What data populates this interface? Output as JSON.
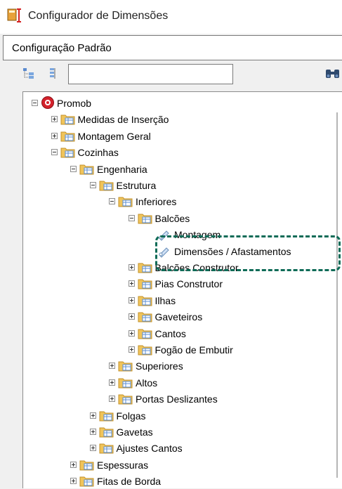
{
  "window": {
    "title": "Configurador de Dimensões",
    "icon": "dimension-configurator-icon"
  },
  "config": {
    "selected": "Configuração Padrão"
  },
  "toolbar": {
    "search_value": "",
    "icons": [
      "expand-tree-icon",
      "collapse-tree-icon",
      "binoculars-search-icon"
    ]
  },
  "tree": {
    "root": "Promob",
    "items": [
      "Medidas de Inserção",
      "Montagem Geral",
      "Cozinhas",
      "Engenharia",
      "Estrutura",
      "Inferiores",
      "Balcões",
      "Montagem",
      "Dimensões / Afastamentos",
      "Balcões Construtor",
      "Pias Construtor",
      "Ilhas",
      "Gaveteiros",
      "Cantos",
      "Fogão de Embutir",
      "Superiores",
      "Altos",
      "Portas Deslizantes",
      "Folgas",
      "Gavetas",
      "Ajustes Cantos",
      "Espessuras",
      "Fitas de Borda"
    ]
  },
  "colors": {
    "highlight": "#0e6b57",
    "folder": "#f0c45a",
    "promob": "#d4212b"
  }
}
